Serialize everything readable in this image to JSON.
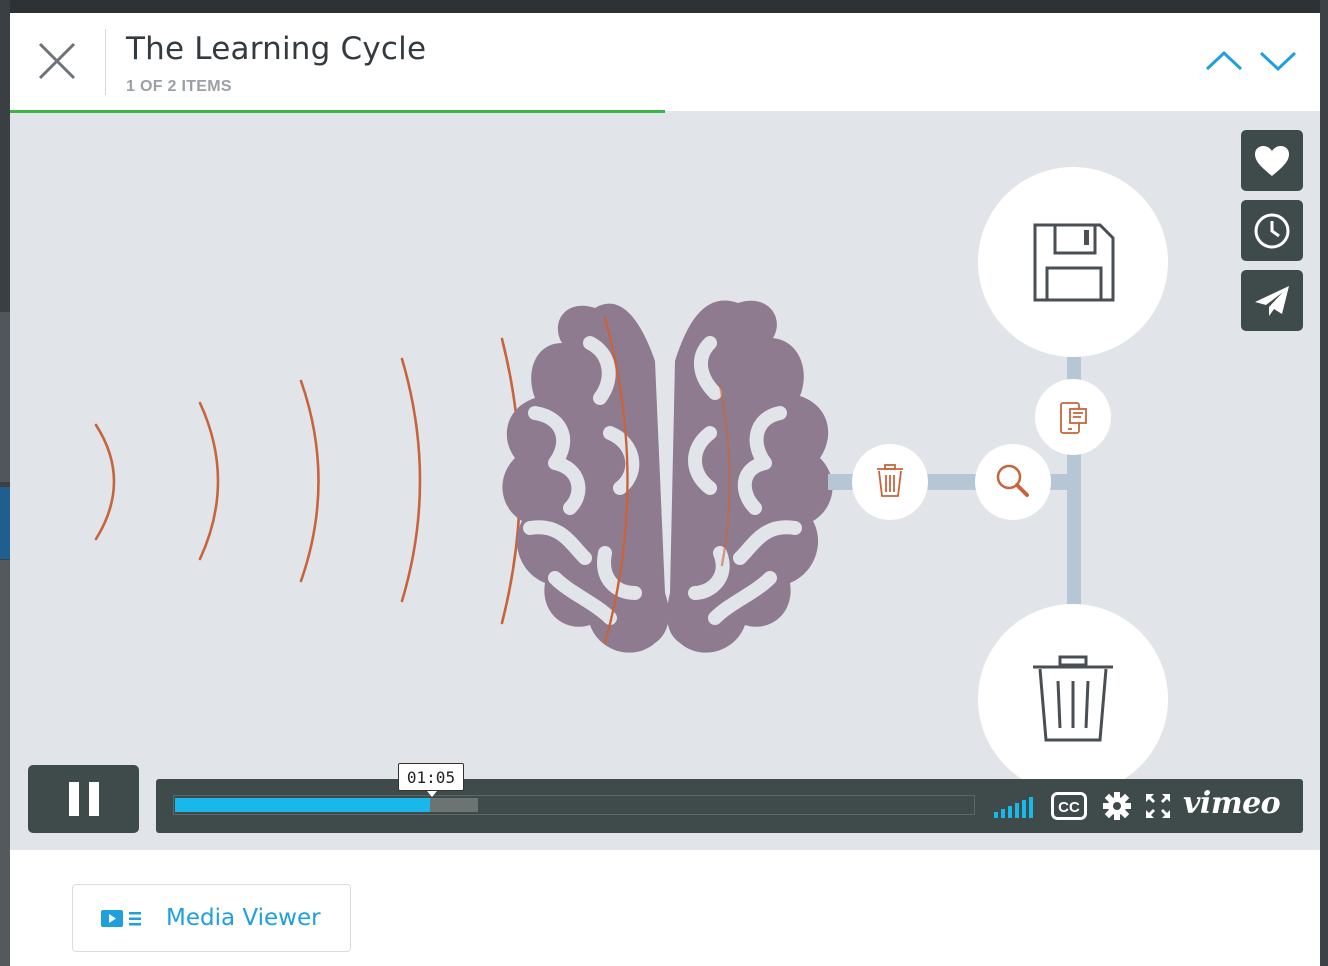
{
  "header": {
    "title": "The Learning Cycle",
    "subtitle": "1 OF 2 ITEMS",
    "progress_fraction": 0.5
  },
  "side_actions": [
    {
      "icon": "heart-icon",
      "label": "Like"
    },
    {
      "icon": "clock-icon",
      "label": "Watch Later"
    },
    {
      "icon": "paper-plane-icon",
      "label": "Share"
    }
  ],
  "player": {
    "current_time": "01:05",
    "played_fraction": 0.32,
    "buffered_fraction": 0.38,
    "brand": "vimeo",
    "icons": [
      "pause-icon",
      "volume-bars-icon",
      "cc-icon",
      "gear-icon",
      "fullscreen-icon"
    ]
  },
  "footer": {
    "media_viewer_label": "Media Viewer"
  },
  "colors": {
    "accent_blue": "#1f9fdc",
    "progress_green": "#3ab54a",
    "player_dark": "#3f4a4a",
    "played_blue": "#1ab7ea",
    "brain_purple": "#8e7b8f",
    "wave_orange": "#c8643c",
    "video_bg": "#e1e5ea"
  }
}
